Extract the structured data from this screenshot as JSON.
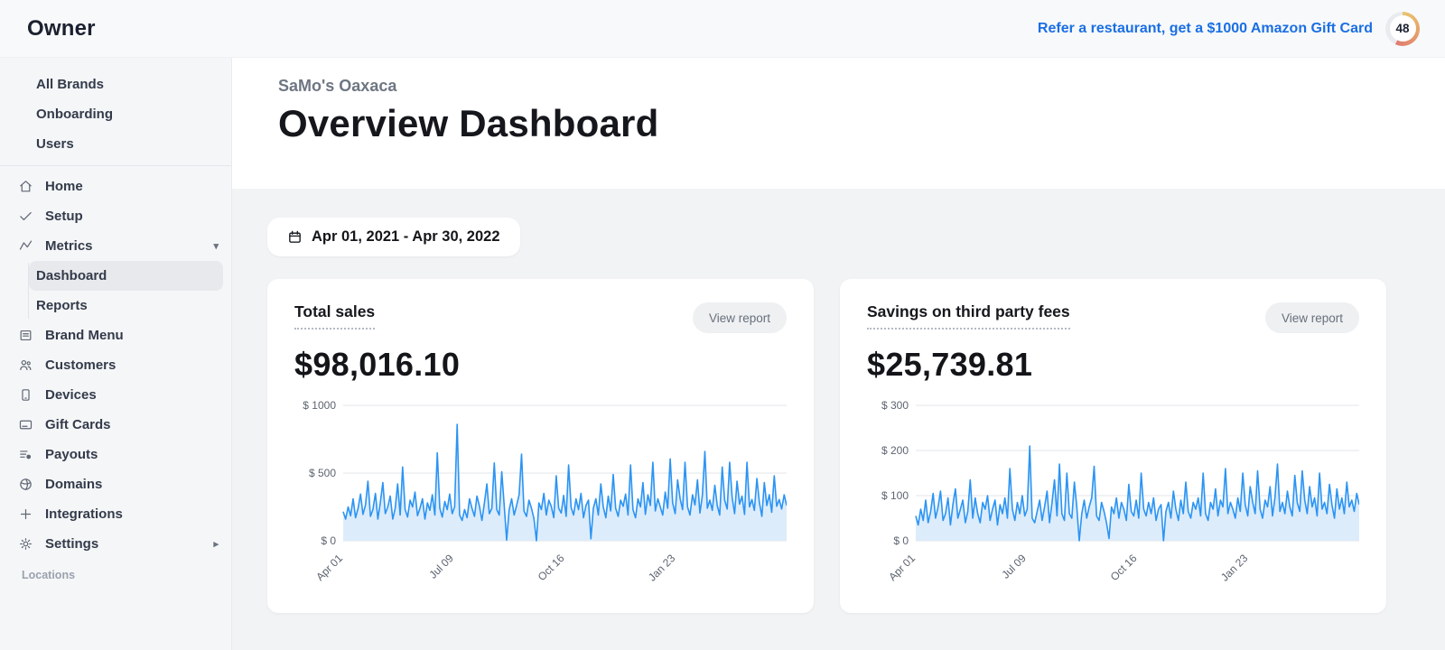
{
  "topbar": {
    "logo": "Owner",
    "referral_link": "Refer a restaurant, get a $1000 Amazon Gift Card",
    "badge": {
      "value": "48",
      "ring_colors": [
        "#eac66d",
        "#e6a06a",
        "#e07a71"
      ],
      "track_color": "#e9ebef",
      "arc_degrees": 205
    }
  },
  "sidebar": {
    "brand_section": [
      {
        "label": "All Brands"
      },
      {
        "label": "Onboarding"
      },
      {
        "label": "Users"
      }
    ],
    "nav": [
      {
        "label": "Home",
        "icon": "home-icon"
      },
      {
        "label": "Setup",
        "icon": "check-icon"
      },
      {
        "label": "Metrics",
        "icon": "metrics-icon",
        "expanded": true
      },
      {
        "label": "Brand Menu",
        "icon": "brand-menu-icon"
      },
      {
        "label": "Customers",
        "icon": "customers-icon"
      },
      {
        "label": "Devices",
        "icon": "devices-icon"
      },
      {
        "label": "Gift Cards",
        "icon": "gift-cards-icon"
      },
      {
        "label": "Payouts",
        "icon": "payouts-icon"
      },
      {
        "label": "Domains",
        "icon": "domains-icon"
      },
      {
        "label": "Integrations",
        "icon": "integrations-icon"
      },
      {
        "label": "Settings",
        "icon": "settings-icon",
        "has_submenu": true
      }
    ],
    "metrics_subnav": [
      {
        "label": "Dashboard",
        "active": true
      },
      {
        "label": "Reports",
        "active": false
      }
    ],
    "footer_label": "Locations"
  },
  "header": {
    "breadcrumb": "SaMo's Oaxaca",
    "title": "Overview Dashboard"
  },
  "filters": {
    "date_range_label": "Apr 01, 2021 - Apr 30, 2022"
  },
  "cards": [
    {
      "title": "Total sales",
      "value": "$98,016.10",
      "action_label": "View report"
    },
    {
      "title": "Savings on third party fees",
      "value": "$25,739.81",
      "action_label": "View report"
    }
  ],
  "colors": {
    "accent_blue": "#1a6fe3",
    "chart_line": "#2b94f3",
    "chart_fill": "#ddecfb",
    "grid_line": "#e3e6ea"
  },
  "chart_data": [
    {
      "type": "line",
      "title": "Total sales",
      "x_start": "Apr 01, 2021",
      "x_end": "Apr 30, 2022",
      "x_tick_labels": [
        "Apr 01",
        "Jul 09",
        "Oct 16",
        "Jan 23"
      ],
      "x_tick_fractions": [
        0,
        0.25,
        0.5,
        0.75
      ],
      "ylim": [
        0,
        1000
      ],
      "y_ticks": [
        0,
        500,
        1000
      ],
      "y_tick_prefix": "$ ",
      "grid": "horizontal",
      "legend": "none",
      "values": [
        215,
        160,
        250,
        185,
        310,
        170,
        240,
        345,
        195,
        265,
        440,
        180,
        230,
        350,
        160,
        280,
        430,
        200,
        250,
        330,
        160,
        240,
        420,
        190,
        545,
        230,
        175,
        300,
        250,
        360,
        185,
        240,
        310,
        160,
        280,
        225,
        340,
        190,
        650,
        240,
        175,
        290,
        230,
        345,
        200,
        250,
        860,
        190,
        150,
        230,
        170,
        310,
        240,
        180,
        330,
        255,
        150,
        280,
        420,
        200,
        240,
        575,
        230,
        190,
        510,
        260,
        5,
        230,
        310,
        190,
        260,
        340,
        640,
        220,
        180,
        300,
        240,
        165,
        0,
        280,
        230,
        350,
        190,
        300,
        255,
        170,
        480,
        240,
        205,
        335,
        180,
        560,
        245,
        190,
        310,
        230,
        350,
        170,
        260,
        300,
        15,
        240,
        310,
        190,
        420,
        250,
        170,
        330,
        220,
        490,
        240,
        180,
        300,
        255,
        345,
        190,
        560,
        230,
        170,
        310,
        250,
        430,
        195,
        340,
        260,
        580,
        220,
        310,
        250,
        190,
        360,
        240,
        605,
        280,
        200,
        450,
        310,
        230,
        580,
        250,
        190,
        340,
        265,
        450,
        205,
        335,
        660,
        240,
        300,
        225,
        410,
        260,
        190,
        545,
        300,
        235,
        580,
        320,
        200,
        440,
        270,
        330,
        195,
        580,
        250,
        305,
        225,
        460,
        285,
        180,
        430,
        260,
        340,
        210,
        480,
        255,
        305,
        235,
        340,
        260
      ]
    },
    {
      "type": "line",
      "title": "Savings on third party fees",
      "x_start": "Apr 01, 2021",
      "x_end": "Apr 30, 2022",
      "x_tick_labels": [
        "Apr 01",
        "Jul 09",
        "Oct 16",
        "Jan 23"
      ],
      "x_tick_fractions": [
        0,
        0.25,
        0.5,
        0.75
      ],
      "ylim": [
        0,
        300
      ],
      "y_ticks": [
        0,
        100,
        200,
        300
      ],
      "y_tick_prefix": "$ ",
      "grid": "horizontal",
      "legend": "none",
      "values": [
        55,
        35,
        70,
        45,
        90,
        40,
        65,
        105,
        50,
        75,
        110,
        45,
        60,
        95,
        35,
        80,
        115,
        50,
        70,
        90,
        40,
        65,
        135,
        50,
        95,
        60,
        40,
        85,
        70,
        100,
        45,
        70,
        90,
        35,
        80,
        60,
        95,
        50,
        160,
        70,
        45,
        85,
        60,
        100,
        55,
        70,
        210,
        50,
        40,
        65,
        90,
        45,
        75,
        110,
        40,
        85,
        135,
        55,
        170,
        60,
        45,
        150,
        60,
        50,
        130,
        75,
        0,
        60,
        90,
        50,
        75,
        95,
        165,
        55,
        45,
        85,
        65,
        40,
        5,
        75,
        60,
        95,
        50,
        85,
        70,
        45,
        125,
        65,
        55,
        90,
        50,
        150,
        70,
        55,
        85,
        60,
        95,
        45,
        70,
        80,
        0,
        65,
        85,
        50,
        110,
        70,
        45,
        90,
        60,
        130,
        65,
        50,
        85,
        70,
        95,
        55,
        150,
        60,
        45,
        85,
        70,
        115,
        55,
        90,
        75,
        160,
        60,
        85,
        70,
        50,
        95,
        65,
        150,
        80,
        55,
        120,
        85,
        60,
        155,
        70,
        50,
        90,
        75,
        120,
        55,
        95,
        170,
        65,
        85,
        60,
        110,
        75,
        55,
        145,
        85,
        65,
        155,
        90,
        60,
        120,
        75,
        95,
        55,
        150,
        70,
        85,
        60,
        125,
        80,
        50,
        115,
        70,
        95,
        60,
        130,
        75,
        90,
        65,
        105,
        80
      ]
    }
  ]
}
